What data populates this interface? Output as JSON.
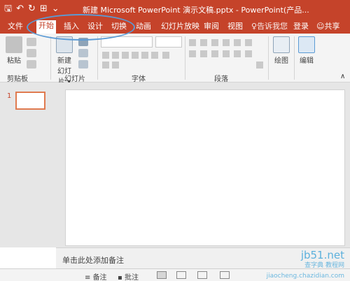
{
  "titlebar": {
    "title": "新建 Microsoft PowerPoint 演示文稿.pptx - PowerPoint(产品...",
    "qat_icons": [
      "save-icon",
      "undo-icon",
      "redo-icon",
      "start-from-beginning-icon",
      "customize-qat-icon"
    ],
    "save_glyph": "🖫",
    "undo_glyph": "↶",
    "redo_glyph": "↻",
    "present_glyph": "⊞",
    "more_glyph": "⌄"
  },
  "tabs": [
    {
      "label": "文件",
      "active": false
    },
    {
      "label": "开始",
      "active": true
    },
    {
      "label": "插入",
      "active": false
    },
    {
      "label": "设计",
      "active": false
    },
    {
      "label": "切换",
      "active": false
    },
    {
      "label": "动画",
      "active": false
    },
    {
      "label": "幻灯片放映",
      "active": false
    },
    {
      "label": "审阅",
      "active": false
    },
    {
      "label": "视图",
      "active": false
    },
    {
      "label": "告诉我您",
      "active": false
    },
    {
      "label": "登录",
      "active": false
    },
    {
      "label": "共享",
      "active": false
    }
  ],
  "tell_me_icon": "lightbulb-icon",
  "share_icon": "person-icon",
  "ribbon": {
    "groups": {
      "clipboard": "剪贴板",
      "slides": "幻灯片",
      "font": "字体",
      "paragraph": "段落"
    },
    "paste_label": "粘贴",
    "new_slide_label": "新建\n幻灯片",
    "new_slide_line1": "新建",
    "new_slide_line2": "幻灯片 ▾",
    "draw_label": "绘图",
    "edit_label": "编辑"
  },
  "thumbnail": {
    "number": "1"
  },
  "notes_placeholder": "单击此处添加备注",
  "statusbar": {
    "notes_label": "备注",
    "comments_label": "批注"
  },
  "watermark": {
    "text": "查字典 教程网",
    "site": "jb51.net",
    "subtext": "jiaocheng.chazidian.com"
  },
  "colors": {
    "accent": "#c5432a",
    "highlight_ellipse": "#5b9bd5"
  }
}
